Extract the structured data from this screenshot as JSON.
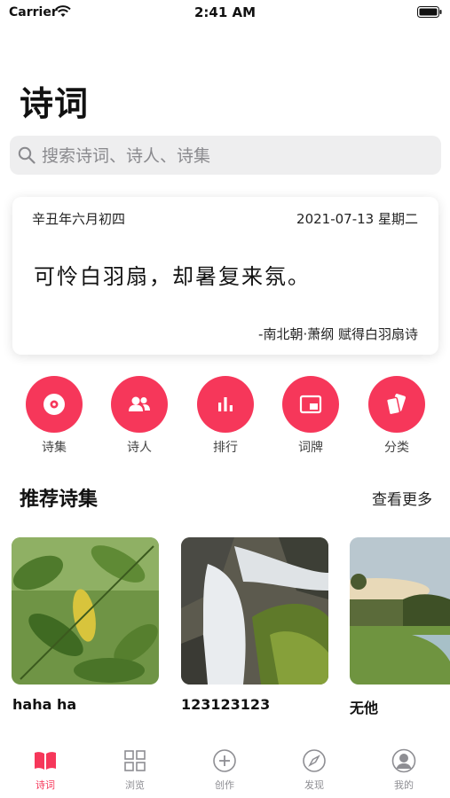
{
  "status_bar": {
    "carrier": "Carrier",
    "time": "2:41 AM"
  },
  "header": {
    "title": "诗词"
  },
  "search": {
    "placeholder": "搜索诗词、诗人、诗集"
  },
  "daily_poem": {
    "lunar_date": "辛丑年六月初四",
    "solar_date": "2021-07-13 星期二",
    "line": "可怜白羽扇，却暑复来氛。",
    "source": "-南北朝·萧纲 赋得白羽扇诗"
  },
  "categories": [
    {
      "label": "诗集",
      "icon": "disc-icon"
    },
    {
      "label": "诗人",
      "icon": "people-icon"
    },
    {
      "label": "排行",
      "icon": "bar-chart-icon"
    },
    {
      "label": "词牌",
      "icon": "picture-in-picture-icon"
    },
    {
      "label": "分类",
      "icon": "cards-icon"
    }
  ],
  "recommended": {
    "title": "推荐诗集",
    "more": "查看更多",
    "items": [
      {
        "name": "haha ha",
        "image": "green-leaves-photo"
      },
      {
        "name": "123123123",
        "image": "waterfall-photo"
      },
      {
        "name": "无他",
        "image": "riverside-sunset-photo"
      }
    ]
  },
  "tab_bar": {
    "items": [
      {
        "label": "诗词",
        "icon": "book-icon",
        "active": true
      },
      {
        "label": "浏览",
        "icon": "grid-icon",
        "active": false
      },
      {
        "label": "创作",
        "icon": "plus-circle-icon",
        "active": false
      },
      {
        "label": "发现",
        "icon": "compass-icon",
        "active": false
      },
      {
        "label": "我的",
        "icon": "user-icon",
        "active": false
      }
    ]
  },
  "colors": {
    "accent": "#f6375a",
    "inactive": "#8e8e93",
    "search_bg": "#eeeeef"
  }
}
